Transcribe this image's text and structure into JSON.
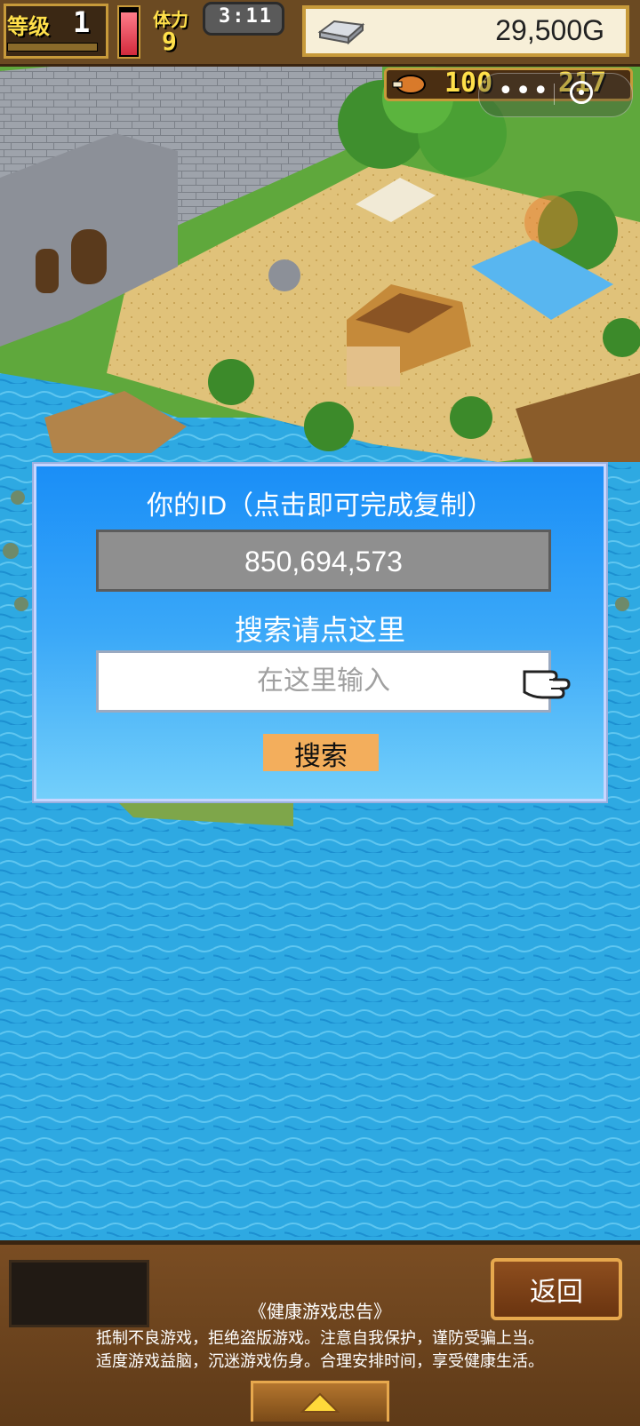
{
  "hud": {
    "level_label": "等级",
    "level_value": "1",
    "stamina_label": "体力",
    "stamina_value": "9",
    "time": "3:11",
    "gold": "29,500G",
    "food_value": "100",
    "other_value": "217"
  },
  "capsule": {
    "more_icon": "more-dots-icon",
    "close_icon": "close-circle-icon"
  },
  "dialog": {
    "id_title": "你的ID（点击即可完成复制）",
    "id_value": "850,694,573",
    "search_title": "搜索请点这里",
    "search_placeholder": "在这里输入",
    "search_button": "搜索"
  },
  "bottom": {
    "back_button": "返回",
    "notice_title": "《健康游戏忠告》",
    "notice_line1": "抵制不良游戏，拒绝盗版游戏。注意自我保护，谨防受骗上当。",
    "notice_line2": "适度游戏益脑，沉迷游戏伤身。合理安排时间，享受健康生活。"
  },
  "colors": {
    "dialog_top": "#1a8ef7",
    "dialog_bottom": "#73cffa",
    "search_button": "#f3ae5c",
    "hud_gold": "#ffe04a",
    "panel_wood": "#6b4522"
  }
}
